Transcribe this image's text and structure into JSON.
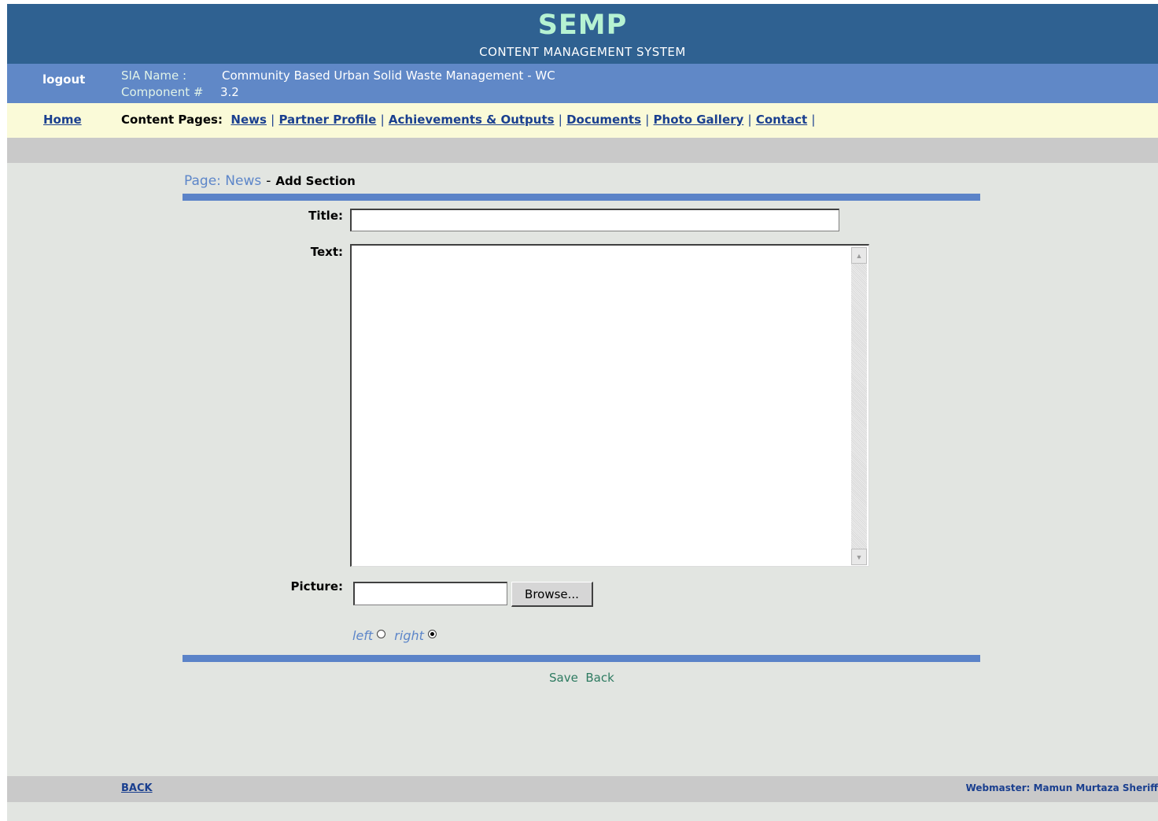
{
  "header": {
    "title": "SEMP",
    "subtitle": "CONTENT MANAGEMENT SYSTEM"
  },
  "infobar": {
    "logout": "logout",
    "sia_label": "SIA Name :",
    "sia_value": "Community Based Urban Solid Waste Management - WC",
    "component_label": "Component #",
    "component_value": "3.2"
  },
  "nav": {
    "home": "Home",
    "content_label": "Content Pages:",
    "links": [
      "News",
      "Partner Profile",
      "Achievements & Outputs",
      "Documents",
      "Photo Gallery",
      "Contact"
    ],
    "separator": "|"
  },
  "breadcrumb": {
    "page": "Page: News",
    "dash": "-",
    "action": "Add Section"
  },
  "form": {
    "title_label": "Title:",
    "title_value": "",
    "text_label": "Text:",
    "text_value": "",
    "picture_label": "Picture:",
    "browse_label": "Browse...",
    "align_left": "left",
    "align_right": "right",
    "align_selected": "right"
  },
  "actions": {
    "save": "Save",
    "back": "Back"
  },
  "footer": {
    "back": "BACK",
    "webmaster": "Webmaster: Mamun Murtaza Sheriff"
  },
  "colors": {
    "header_bg": "#2f6191",
    "title": "#b6f2d2",
    "infobar_bg": "#6088c7",
    "nav_bg": "#fafad8",
    "link": "#1a3f8f",
    "rule": "#5b83c8",
    "page_bg": "#e2e5e1",
    "action_text": "#2e7b61"
  }
}
